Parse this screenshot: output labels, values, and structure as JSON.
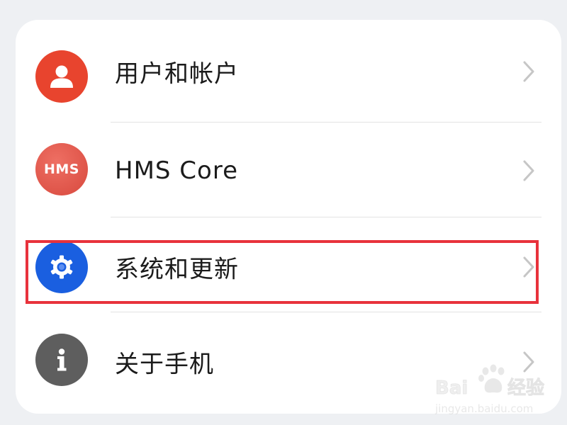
{
  "settings_list": {
    "items": [
      {
        "id": "users",
        "label": "用户和帐户",
        "icon": "user-icon",
        "icon_bg": "#e8442e"
      },
      {
        "id": "hms",
        "label": "HMS Core",
        "icon": "hms-icon",
        "icon_text": "HMS",
        "icon_bg": "#e0564a"
      },
      {
        "id": "system",
        "label": "系统和更新",
        "icon": "gear-icon",
        "icon_bg": "#1a5fe0"
      },
      {
        "id": "about",
        "label": "关于手机",
        "icon": "info-icon",
        "icon_bg": "#5e5e5e"
      }
    ]
  },
  "highlight": {
    "target": "系统和更新",
    "color": "#e8323c"
  },
  "watermark": {
    "brand": "Bai du 经验",
    "url": "jingyan.baidu.com"
  }
}
